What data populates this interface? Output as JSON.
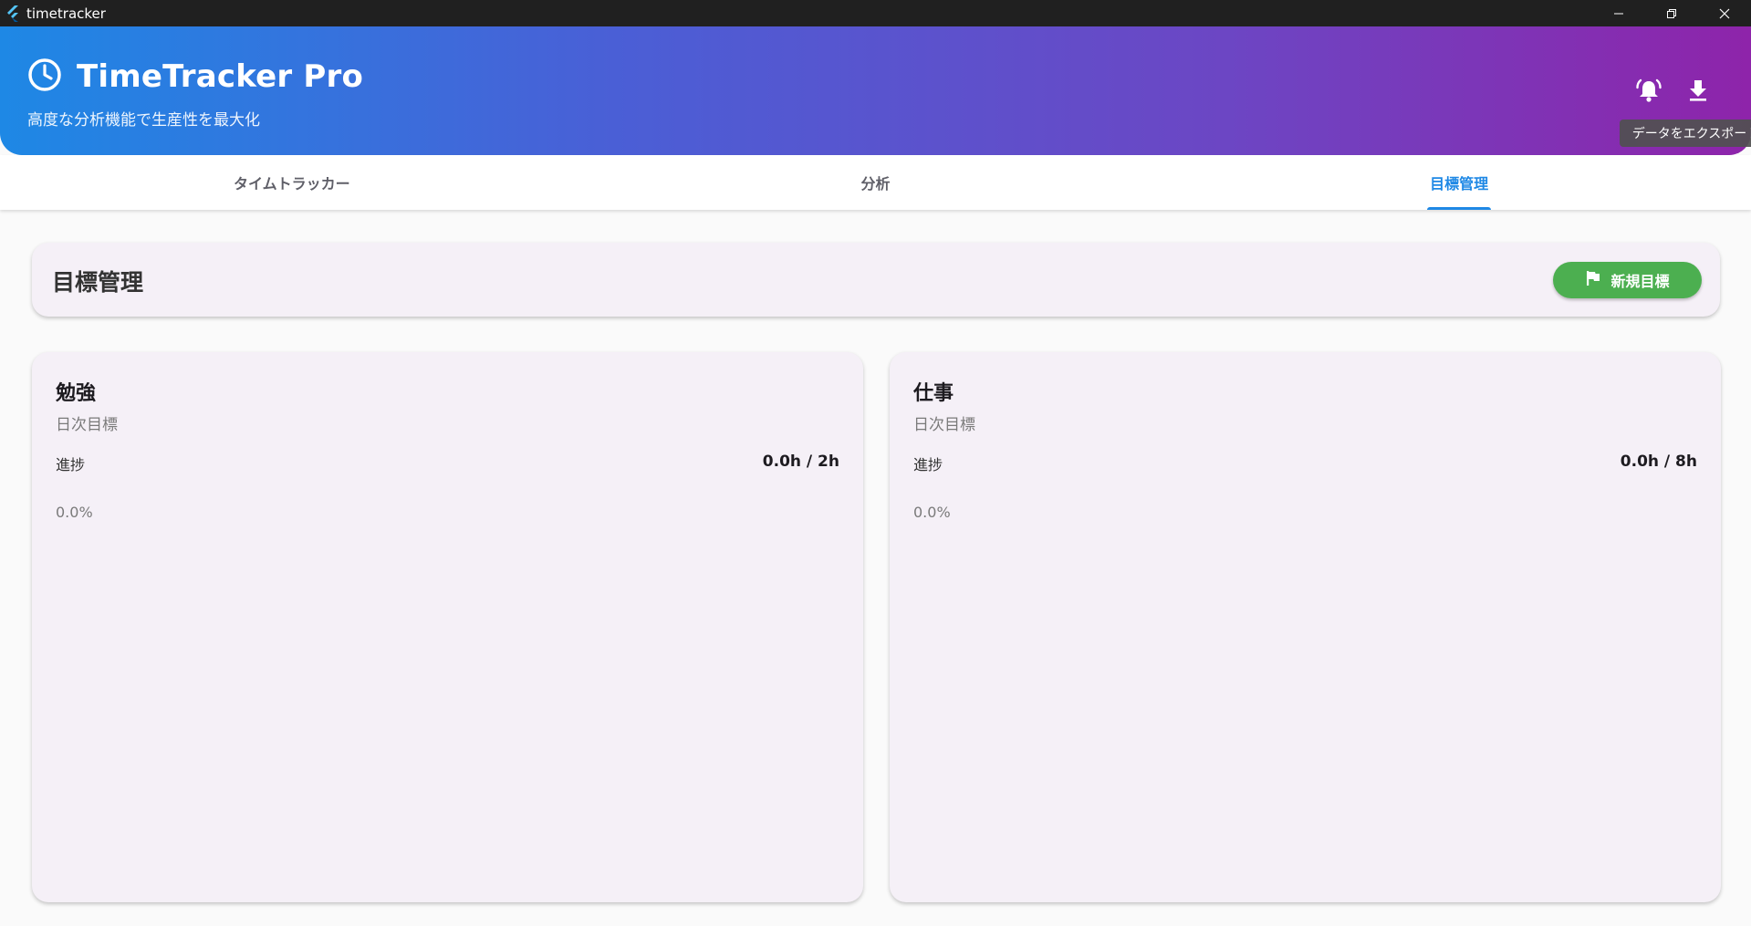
{
  "window": {
    "title": "timetracker"
  },
  "header": {
    "app_name": "TimeTracker Pro",
    "tagline": "高度な分析機能で生産性を最大化",
    "tooltip": "データをエクスポート"
  },
  "tabs": [
    {
      "label": "タイムトラッカー",
      "active": false
    },
    {
      "label": "分析",
      "active": false
    },
    {
      "label": "目標管理",
      "active": true
    }
  ],
  "section": {
    "title": "目標管理",
    "new_goal_label": "新規目標"
  },
  "goals": [
    {
      "name": "勉強",
      "period": "日次目標",
      "progress_label": "進捗",
      "progress_value": "0.0h / 2h",
      "progress_percent": "0.0%",
      "progress_fraction": 0.0
    },
    {
      "name": "仕事",
      "period": "日次目標",
      "progress_label": "進捗",
      "progress_value": "0.0h / 8h",
      "progress_percent": "0.0%",
      "progress_fraction": 0.0
    }
  ],
  "colors": {
    "accent": "#1e88e5",
    "header_gradient_start": "#1e88e5",
    "header_gradient_end": "#8e24aa",
    "success": "#4caf50",
    "card_background": "#f5f0f7"
  },
  "icons": {
    "app": "flutter-logo-icon",
    "logo": "clock-icon",
    "notification": "alarm-icon",
    "export": "download-icon",
    "new_goal": "flag-icon",
    "minimize": "minimize-icon",
    "maximize": "restore-icon",
    "close": "close-icon"
  }
}
